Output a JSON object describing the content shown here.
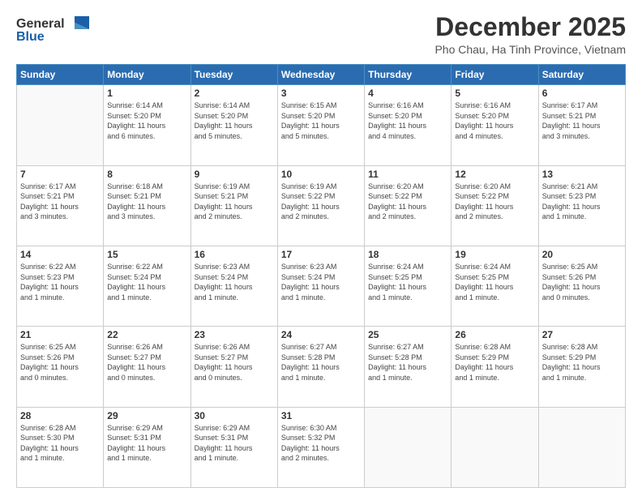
{
  "logo": {
    "general": "General",
    "blue": "Blue"
  },
  "header": {
    "month": "December 2025",
    "location": "Pho Chau, Ha Tinh Province, Vietnam"
  },
  "weekdays": [
    "Sunday",
    "Monday",
    "Tuesday",
    "Wednesday",
    "Thursday",
    "Friday",
    "Saturday"
  ],
  "weeks": [
    [
      {
        "day": "",
        "info": ""
      },
      {
        "day": "1",
        "info": "Sunrise: 6:14 AM\nSunset: 5:20 PM\nDaylight: 11 hours\nand 6 minutes."
      },
      {
        "day": "2",
        "info": "Sunrise: 6:14 AM\nSunset: 5:20 PM\nDaylight: 11 hours\nand 5 minutes."
      },
      {
        "day": "3",
        "info": "Sunrise: 6:15 AM\nSunset: 5:20 PM\nDaylight: 11 hours\nand 5 minutes."
      },
      {
        "day": "4",
        "info": "Sunrise: 6:16 AM\nSunset: 5:20 PM\nDaylight: 11 hours\nand 4 minutes."
      },
      {
        "day": "5",
        "info": "Sunrise: 6:16 AM\nSunset: 5:20 PM\nDaylight: 11 hours\nand 4 minutes."
      },
      {
        "day": "6",
        "info": "Sunrise: 6:17 AM\nSunset: 5:21 PM\nDaylight: 11 hours\nand 3 minutes."
      }
    ],
    [
      {
        "day": "7",
        "info": "Sunrise: 6:17 AM\nSunset: 5:21 PM\nDaylight: 11 hours\nand 3 minutes."
      },
      {
        "day": "8",
        "info": "Sunrise: 6:18 AM\nSunset: 5:21 PM\nDaylight: 11 hours\nand 3 minutes."
      },
      {
        "day": "9",
        "info": "Sunrise: 6:19 AM\nSunset: 5:21 PM\nDaylight: 11 hours\nand 2 minutes."
      },
      {
        "day": "10",
        "info": "Sunrise: 6:19 AM\nSunset: 5:22 PM\nDaylight: 11 hours\nand 2 minutes."
      },
      {
        "day": "11",
        "info": "Sunrise: 6:20 AM\nSunset: 5:22 PM\nDaylight: 11 hours\nand 2 minutes."
      },
      {
        "day": "12",
        "info": "Sunrise: 6:20 AM\nSunset: 5:22 PM\nDaylight: 11 hours\nand 2 minutes."
      },
      {
        "day": "13",
        "info": "Sunrise: 6:21 AM\nSunset: 5:23 PM\nDaylight: 11 hours\nand 1 minute."
      }
    ],
    [
      {
        "day": "14",
        "info": "Sunrise: 6:22 AM\nSunset: 5:23 PM\nDaylight: 11 hours\nand 1 minute."
      },
      {
        "day": "15",
        "info": "Sunrise: 6:22 AM\nSunset: 5:24 PM\nDaylight: 11 hours\nand 1 minute."
      },
      {
        "day": "16",
        "info": "Sunrise: 6:23 AM\nSunset: 5:24 PM\nDaylight: 11 hours\nand 1 minute."
      },
      {
        "day": "17",
        "info": "Sunrise: 6:23 AM\nSunset: 5:24 PM\nDaylight: 11 hours\nand 1 minute."
      },
      {
        "day": "18",
        "info": "Sunrise: 6:24 AM\nSunset: 5:25 PM\nDaylight: 11 hours\nand 1 minute."
      },
      {
        "day": "19",
        "info": "Sunrise: 6:24 AM\nSunset: 5:25 PM\nDaylight: 11 hours\nand 1 minute."
      },
      {
        "day": "20",
        "info": "Sunrise: 6:25 AM\nSunset: 5:26 PM\nDaylight: 11 hours\nand 0 minutes."
      }
    ],
    [
      {
        "day": "21",
        "info": "Sunrise: 6:25 AM\nSunset: 5:26 PM\nDaylight: 11 hours\nand 0 minutes."
      },
      {
        "day": "22",
        "info": "Sunrise: 6:26 AM\nSunset: 5:27 PM\nDaylight: 11 hours\nand 0 minutes."
      },
      {
        "day": "23",
        "info": "Sunrise: 6:26 AM\nSunset: 5:27 PM\nDaylight: 11 hours\nand 0 minutes."
      },
      {
        "day": "24",
        "info": "Sunrise: 6:27 AM\nSunset: 5:28 PM\nDaylight: 11 hours\nand 1 minute."
      },
      {
        "day": "25",
        "info": "Sunrise: 6:27 AM\nSunset: 5:28 PM\nDaylight: 11 hours\nand 1 minute."
      },
      {
        "day": "26",
        "info": "Sunrise: 6:28 AM\nSunset: 5:29 PM\nDaylight: 11 hours\nand 1 minute."
      },
      {
        "day": "27",
        "info": "Sunrise: 6:28 AM\nSunset: 5:29 PM\nDaylight: 11 hours\nand 1 minute."
      }
    ],
    [
      {
        "day": "28",
        "info": "Sunrise: 6:28 AM\nSunset: 5:30 PM\nDaylight: 11 hours\nand 1 minute."
      },
      {
        "day": "29",
        "info": "Sunrise: 6:29 AM\nSunset: 5:31 PM\nDaylight: 11 hours\nand 1 minute."
      },
      {
        "day": "30",
        "info": "Sunrise: 6:29 AM\nSunset: 5:31 PM\nDaylight: 11 hours\nand 1 minute."
      },
      {
        "day": "31",
        "info": "Sunrise: 6:30 AM\nSunset: 5:32 PM\nDaylight: 11 hours\nand 2 minutes."
      },
      {
        "day": "",
        "info": ""
      },
      {
        "day": "",
        "info": ""
      },
      {
        "day": "",
        "info": ""
      }
    ]
  ]
}
